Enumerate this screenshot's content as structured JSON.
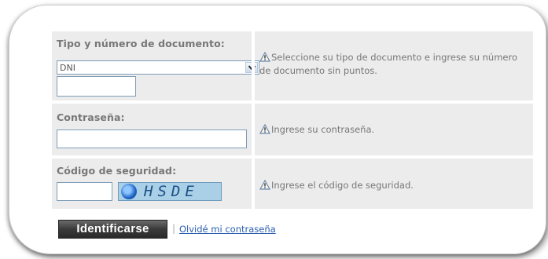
{
  "form": {
    "document": {
      "label": "Tipo y número de documento:",
      "selected_type": "DNI",
      "number_value": "",
      "hint": "Seleccione su tipo de documento e ingrese su número de documento sin puntos."
    },
    "password": {
      "label": "Contraseña:",
      "value": "",
      "hint": "Ingrese su contraseña."
    },
    "security": {
      "label": "Código de seguridad:",
      "value": "",
      "captcha_text": "HSDE",
      "hint": "Ingrese el código de seguridad."
    }
  },
  "actions": {
    "submit_label": "Identificarse",
    "separator": "|",
    "forgot_link": "Olvidé mi contraseña"
  },
  "icons": {
    "warning": "warning-triangle-icon",
    "dropdown": "chevron-down-icon"
  },
  "colors": {
    "label": "#777777",
    "row_bg": "#ececec",
    "link": "#2a5db0",
    "button_bg": "#3a3a3a"
  }
}
